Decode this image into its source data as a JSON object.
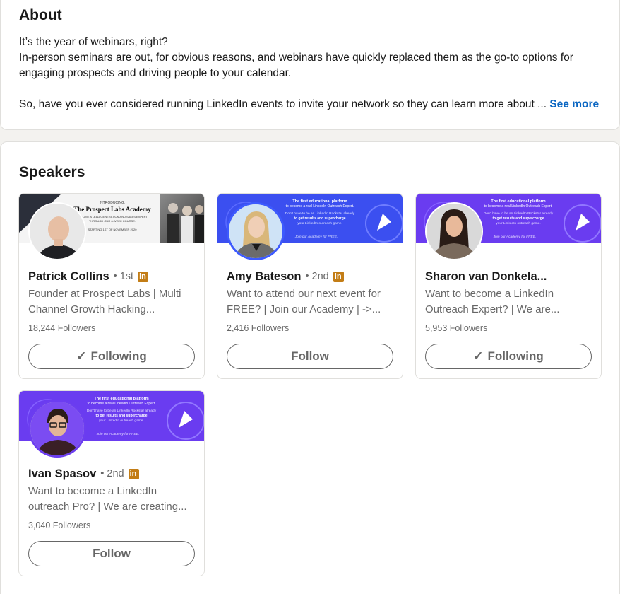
{
  "about": {
    "title": "About",
    "line1": "It’s the year of webinars, right?",
    "line2": "In-person seminars are out, for obvious reasons, and webinars have quickly replaced them as the go-to options for",
    "line3": "engaging prospects and driving people to your calendar.",
    "line4": "So, have you ever considered running LinkedIn events to invite your network so they can learn more about ...",
    "see_more": "See more"
  },
  "speakers": {
    "title": "Speakers",
    "items": [
      {
        "name": "Patrick Collins",
        "degree": "• 1st",
        "headline_1": "Founder at Prospect Labs | Multi",
        "headline_2": "Channel Growth Hacking...",
        "followers": "18,244 Followers",
        "button": "Following",
        "button_icon": "check-icon"
      },
      {
        "name": "Amy Bateson",
        "degree": "• 2nd",
        "headline_1": "Want to attend our next event for",
        "headline_2": "FREE? | Join our Academy | ->...",
        "followers": "2,416 Followers",
        "button": "Follow"
      },
      {
        "name": "Sharon van Donkela...",
        "degree": "",
        "headline_1": "Want to become a LinkedIn",
        "headline_2": "Outreach Expert? | We are...",
        "followers": "5,953 Followers",
        "button": "Following",
        "button_icon": "check-icon"
      },
      {
        "name": "Ivan Spasov",
        "degree": "• 2nd",
        "headline_1": "Want to become a LinkedIn",
        "headline_2": "outreach Pro? | We are creating...",
        "followers": "3,040 Followers",
        "button": "Follow"
      }
    ]
  },
  "banners": {
    "prospect": {
      "l1": "INTRODUCING:",
      "l2": "The Prospect Labs Academy",
      "l3": "BECOME A LEAD GENERATION AND SALES EXPERT",
      "l4": "THROUGH OUR 6-WEEK COURSE.",
      "l5": "STARTING 1ST OF NOVEMBER 2020"
    },
    "academy": {
      "l1": "The first educational platform",
      "l2": "to become a real LinkedIn Outreach Expert.",
      "l3": "Don't have to be an LinkedIn Rockstar already",
      "l4": "to get results and supercharge",
      "l5": "your LinkedIn outreach game.",
      "l6": "Join our Academy for FREE."
    }
  },
  "colors": {
    "link": "#0a66c2",
    "banner_blue": "#3a4ef0",
    "banner_purple": "#6a3cf0",
    "linkedin_badge": "#c37d16"
  }
}
